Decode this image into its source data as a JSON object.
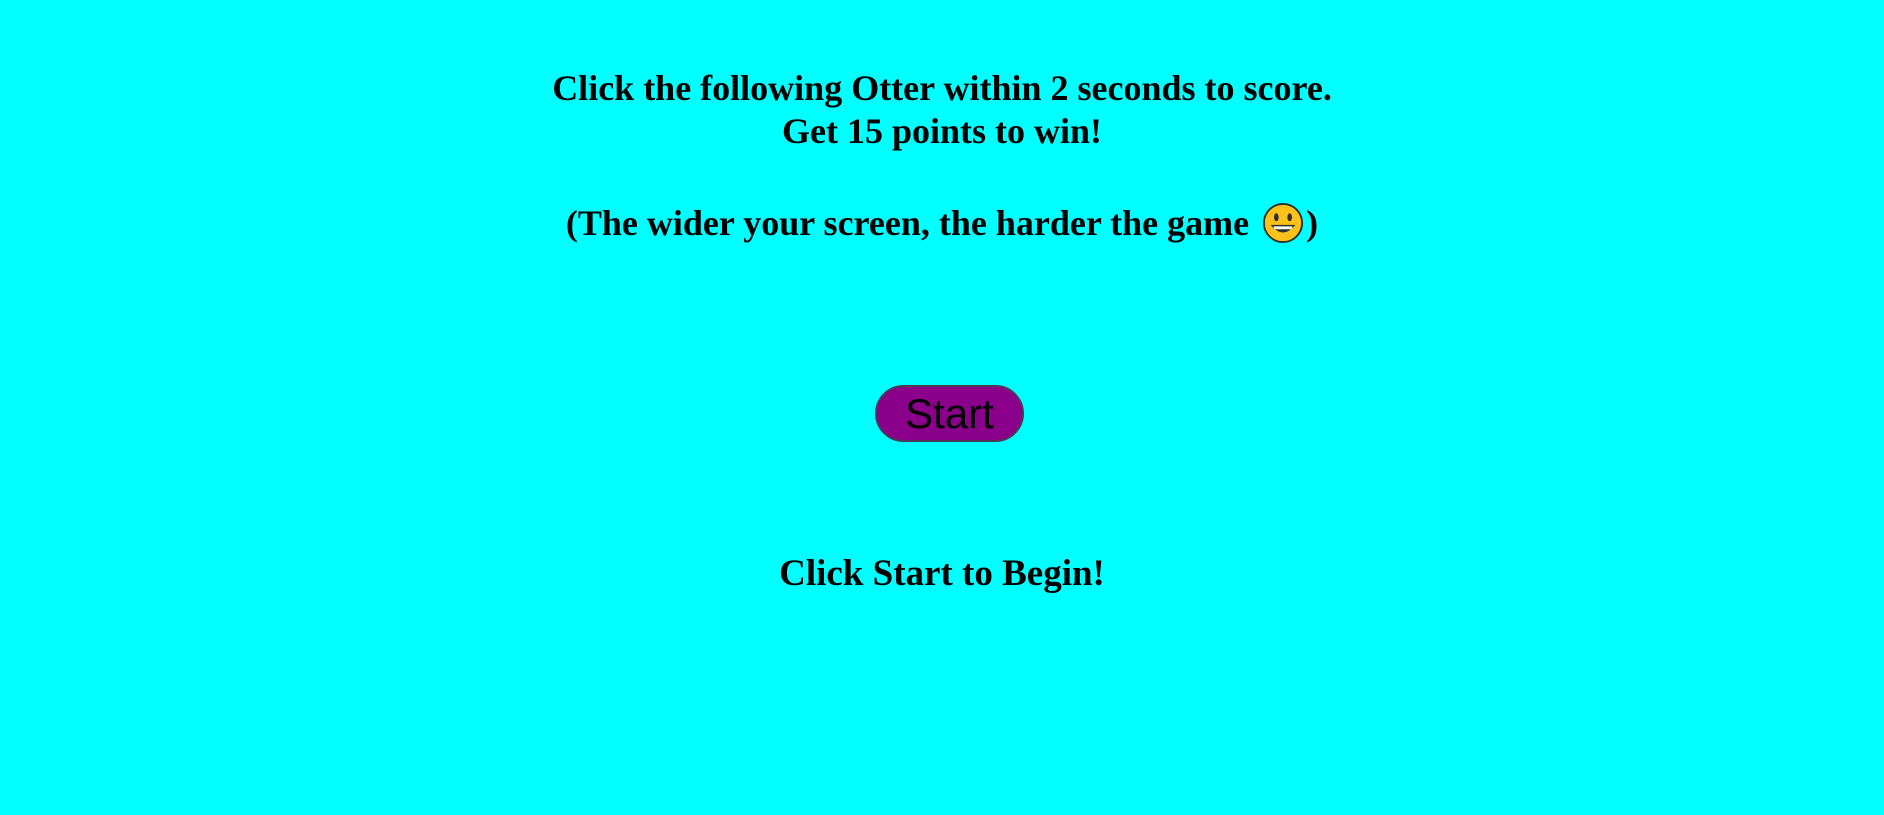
{
  "instructions": {
    "line1": "Click the following Otter within 2 seconds to score.",
    "line2": "Get 15 points to win!",
    "note_text": "(The wider your screen, the harder the game ",
    "note_icon": "grinning-face-emoji",
    "note_close": ")"
  },
  "start_button": {
    "label": "Start"
  },
  "status": {
    "message": "Click Start to Begin!"
  },
  "colors": {
    "background": "#00ffff",
    "button_fill": "#8b008b",
    "text": "#000000"
  }
}
